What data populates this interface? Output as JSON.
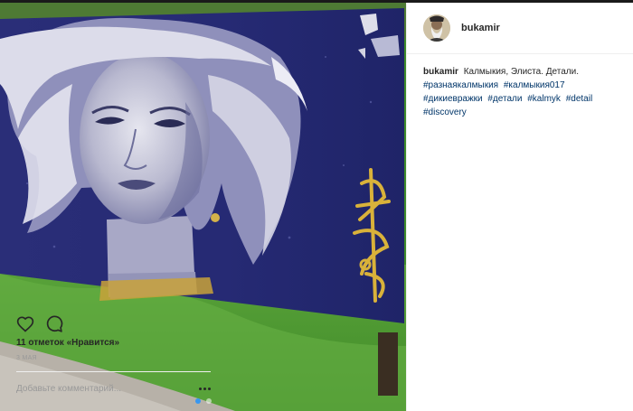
{
  "post": {
    "image_alt": "Граффити: женское лицо на синем заборе",
    "carousel_dots": 2,
    "active_dot": 0
  },
  "header": {
    "username": "bukamir"
  },
  "caption": {
    "author": "bukamir",
    "text": "Калмыкия, Элиста. Детали.",
    "hashtags": [
      "#разнаякалмыкия",
      "#калмыкия017",
      "#дикиевражки",
      "#детали",
      "#kalmyk",
      "#detail",
      "#discovery"
    ]
  },
  "actions": {
    "like_icon": "heart-icon",
    "comment_icon": "comment-bubble-icon"
  },
  "likes_text": "11 отметок «Нравится»",
  "date_text": "3 мая",
  "comment": {
    "placeholder": "Добавьте комментарий...",
    "more_icon": "more-options-icon"
  },
  "colors": {
    "hashtag": "#003569",
    "text": "#262626",
    "muted": "#999999",
    "border": "#efefef",
    "active_dot": "#3897f0"
  }
}
